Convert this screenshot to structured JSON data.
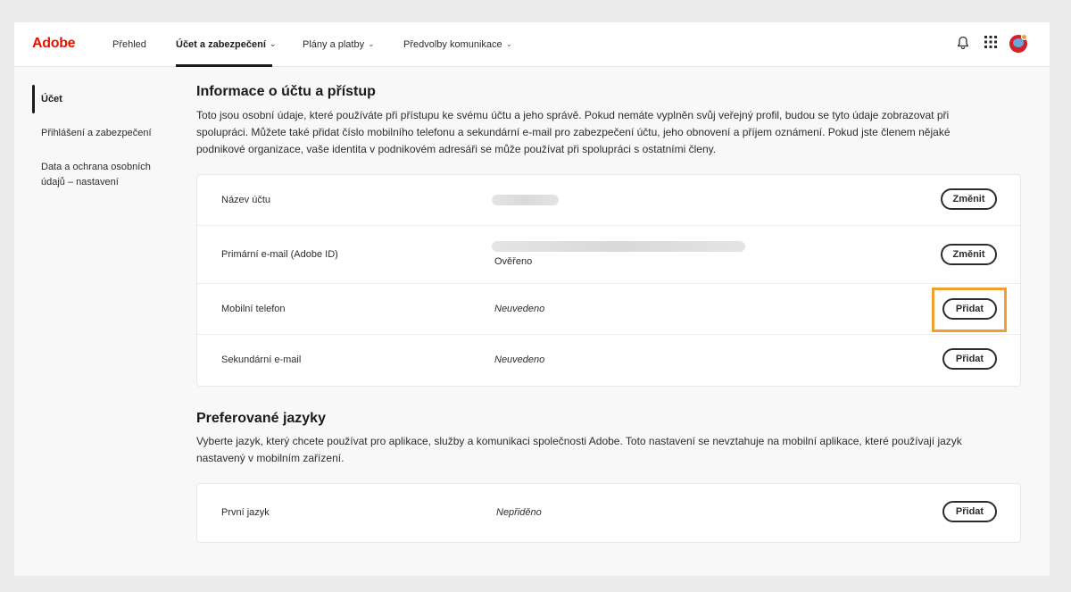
{
  "header": {
    "logo": "Adobe",
    "nav": [
      {
        "label": "Přehled"
      },
      {
        "label": "Účet a zabezpečení"
      },
      {
        "label": "Plány a platby"
      },
      {
        "label": "Předvolby komunikace"
      }
    ],
    "active_nav": "Účet a zabezpečení",
    "icons": [
      "bell-icon",
      "app-grid-icon",
      "avatar"
    ]
  },
  "sidebar": {
    "items": [
      {
        "label": "Účet"
      },
      {
        "label": "Přihlášení a zabezpečení"
      },
      {
        "label": "Data a ochrana osobních údajů – nastavení"
      }
    ],
    "active": "Účet"
  },
  "account_section": {
    "title": "Informace o účtu a přístup",
    "description": "Toto jsou osobní údaje, které používáte při přístupu ke svému účtu a jeho správě. Pokud nemáte vyplněn svůj veřejný profil, budou se tyto údaje zobrazovat při spolupráci. Můžete také přidat číslo mobilního telefonu a sekundární e-mail pro zabezpečení účtu, jeho obnovení a příjem oznámení. Pokud jste členem nějaké podnikové organizace, vaše identita v podnikovém adresáři se může používat při spolupráci s ostatními členy.",
    "rows": [
      {
        "label": "Název účtu",
        "value": "",
        "button": "Změnit"
      },
      {
        "label": "Primární e-mail (Adobe ID)",
        "value": "",
        "sub": "Ověřeno",
        "button": "Změnit"
      },
      {
        "label": "Mobilní telefon",
        "value": "Neuvedeno",
        "button": "Přidat"
      },
      {
        "label": "Sekundární e-mail",
        "value": "Neuvedeno",
        "button": "Přidat"
      }
    ]
  },
  "language_section": {
    "title": "Preferované jazyky",
    "description": "Vyberte jazyk, který chcete používat pro aplikace, služby a komunikaci společnosti Adobe. Toto nastavení se nevztahuje na mobilní aplikace, které používají jazyk nastavený v mobilním zařízení.",
    "rows": [
      {
        "label": "První jazyk",
        "value": "Nepřiděno",
        "button": "Přidat"
      }
    ]
  },
  "colors": {
    "brand": "#eb1000",
    "highlight": "#f0a030",
    "text": "#2c2c2c"
  }
}
